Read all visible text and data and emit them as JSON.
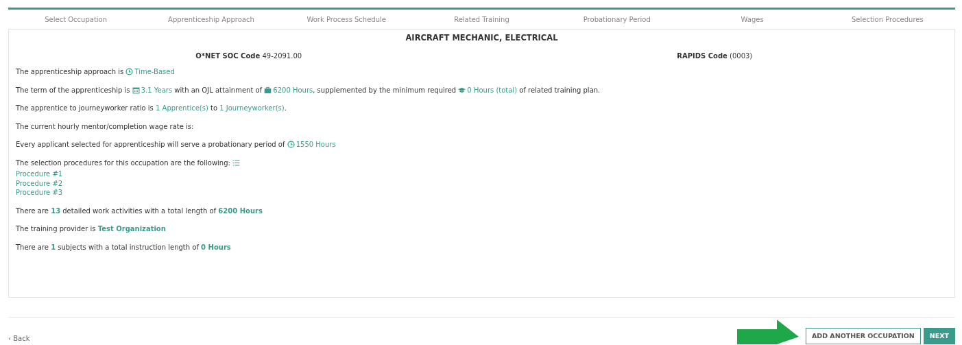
{
  "steps": [
    {
      "label": "Select Occupation",
      "selected": false
    },
    {
      "label": "Apprenticeship Approach",
      "selected": false
    },
    {
      "label": "Work Process Schedule",
      "selected": false
    },
    {
      "label": "Related Training",
      "selected": false
    },
    {
      "label": "Probationary Period",
      "selected": false
    },
    {
      "label": "Wages",
      "selected": false
    },
    {
      "label": "Selection Procedures",
      "selected": false
    }
  ],
  "occupation": {
    "title": "AIRCRAFT MECHANIC, ELECTRICAL",
    "codes": [
      {
        "label": "O*NET SOC Code",
        "value": "49-2091.00"
      },
      {
        "label": "RAPIDS Code",
        "value": "(0003)"
      }
    ]
  },
  "lines": [
    {
      "parts": [
        {
          "kind": "text",
          "text": "The apprenticeship approach is "
        },
        {
          "kind": "link",
          "text": "Time-Based"
        }
      ]
    },
    {
      "parts": [
        {
          "kind": "text",
          "text": "The term of the apprenticeship is "
        },
        {
          "kind": "link",
          "text": "3.1 Years"
        },
        {
          "kind": "text",
          "text": " with an OJL attainment of "
        },
        {
          "kind": "link",
          "text": "6200 Hours"
        },
        {
          "kind": "text",
          "text": ", supplemented by the minimum required "
        },
        {
          "kind": "link",
          "text": "0 Hours (total)"
        },
        {
          "kind": "text",
          "text": " of related training plan."
        }
      ]
    },
    {
      "parts": [
        {
          "kind": "text",
          "text": "The apprentice to journeyworker ratio is "
        },
        {
          "kind": "link",
          "text": "1 Apprentice(s)"
        },
        {
          "kind": "text",
          "text": " to "
        },
        {
          "kind": "link",
          "text": "1 Journeyworker(s)"
        },
        {
          "kind": "text",
          "text": "."
        }
      ]
    },
    {
      "parts": [
        {
          "kind": "text",
          "text": "The current hourly mentor/completion wage rate is:"
        }
      ]
    },
    {
      "parts": [
        {
          "kind": "text",
          "text": "Every applicant selected for apprenticeship will serve a probationary period of "
        },
        {
          "kind": "link",
          "text": "1550 Hours"
        }
      ]
    },
    {
      "parts": [
        {
          "kind": "text",
          "text": "The selection procedures for this occupation are the following: "
        },
        {
          "kind": "icon"
        }
      ],
      "items": [
        "Procedure #1",
        "Procedure #2",
        "Procedure #3"
      ]
    },
    {
      "parts": [
        {
          "kind": "text",
          "text": "There are "
        },
        {
          "kind": "strong",
          "text": "13"
        },
        {
          "kind": "text",
          "text": " detailed work activities with a total length of "
        },
        {
          "kind": "strong",
          "text": "6200 Hours"
        }
      ]
    },
    {
      "parts": [
        {
          "kind": "text",
          "text": "The training provider is "
        },
        {
          "kind": "strong",
          "text": "Test Organization"
        }
      ]
    },
    {
      "parts": [
        {
          "kind": "text",
          "text": "There are "
        },
        {
          "kind": "strong",
          "text": "1"
        },
        {
          "kind": "text",
          "text": " subjects with a total instruction length of "
        },
        {
          "kind": "strong",
          "text": "0 Hours"
        }
      ]
    }
  ],
  "back": {
    "icon": "‹",
    "label": "Back"
  },
  "buttons": [
    {
      "label": "ADD ANOTHER OCCUPATION",
      "kind": "outline"
    },
    {
      "label": "NEXT",
      "kind": "primary"
    }
  ]
}
